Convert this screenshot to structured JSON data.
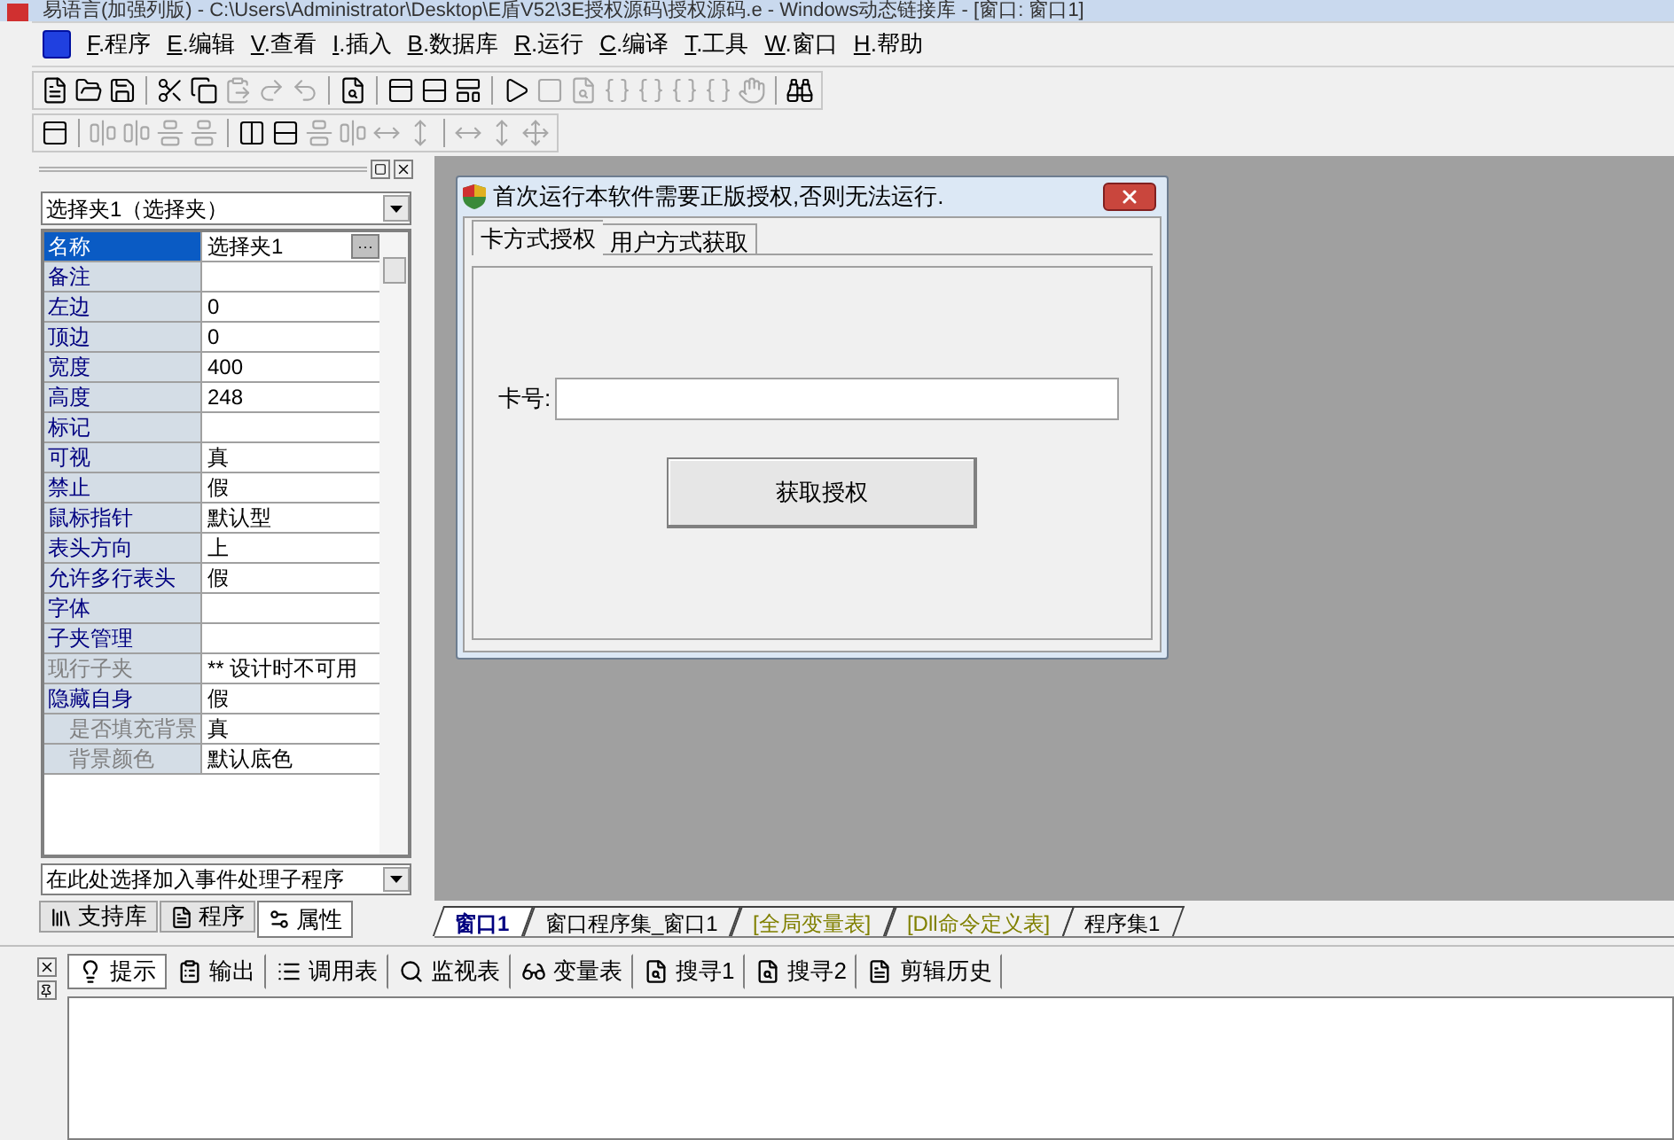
{
  "title_bar": {
    "title": "易语言(加强列版) - C:\\Users\\Administrator\\Desktop\\E盾V52\\3E授权源码\\授权源码.e - Windows动态链接库 - [窗口: 窗口1]"
  },
  "menu": [
    {
      "key": "F",
      "label": ".程序"
    },
    {
      "key": "E",
      "label": ".编辑"
    },
    {
      "key": "V",
      "label": ".查看"
    },
    {
      "key": "I",
      "label": ".插入"
    },
    {
      "key": "B",
      "label": ".数据库"
    },
    {
      "key": "R",
      "label": ".运行"
    },
    {
      "key": "C",
      "label": ".编译"
    },
    {
      "key": "T",
      "label": ".工具"
    },
    {
      "key": "W",
      "label": ".窗口"
    },
    {
      "key": "H",
      "label": ".帮助"
    }
  ],
  "properties": {
    "object_selector": "选择夹1（选择夹）",
    "rows": [
      {
        "name": "名称",
        "value": "选择夹1",
        "selected": true,
        "disabled": false,
        "button": "···"
      },
      {
        "name": "备注",
        "value": "",
        "selected": false,
        "disabled": false
      },
      {
        "name": "左边",
        "value": "0",
        "selected": false,
        "disabled": false
      },
      {
        "name": "顶边",
        "value": "0",
        "selected": false,
        "disabled": false
      },
      {
        "name": "宽度",
        "value": "400",
        "selected": false,
        "disabled": false
      },
      {
        "name": "高度",
        "value": "248",
        "selected": false,
        "disabled": false
      },
      {
        "name": "标记",
        "value": "",
        "selected": false,
        "disabled": false
      },
      {
        "name": "可视",
        "value": "真",
        "selected": false,
        "disabled": false
      },
      {
        "name": "禁止",
        "value": "假",
        "selected": false,
        "disabled": false
      },
      {
        "name": "鼠标指针",
        "value": "默认型",
        "selected": false,
        "disabled": false
      },
      {
        "name": "表头方向",
        "value": "上",
        "selected": false,
        "disabled": false
      },
      {
        "name": "允许多行表头",
        "value": "假",
        "selected": false,
        "disabled": false
      },
      {
        "name": "字体",
        "value": "",
        "selected": false,
        "disabled": false
      },
      {
        "name": "子夹管理",
        "value": "",
        "selected": false,
        "disabled": false
      },
      {
        "name": "现行子夹",
        "value": "** 设计时不可用",
        "selected": false,
        "disabled": true
      },
      {
        "name": "隐藏自身",
        "value": "假",
        "selected": false,
        "disabled": false,
        "children": [
          {
            "name": "是否填充背景",
            "value": "真",
            "selected": false,
            "disabled": true
          },
          {
            "name": "背景颜色",
            "value": "默认底色",
            "selected": false,
            "disabled": true
          }
        ]
      }
    ]
  },
  "event_selector": "在此处选择加入事件处理子程序",
  "panel_tabs": [
    {
      "label": "支持库",
      "selected": false
    },
    {
      "label": "程序",
      "selected": false
    },
    {
      "label": "属性",
      "selected": true
    }
  ],
  "dialog": {
    "title": "首次运行本软件需要正版授权,否则无法运行.",
    "tabs": [
      {
        "label": "卡方式授权",
        "selected": true
      },
      {
        "label": "用户方式获取",
        "selected": false
      }
    ],
    "card_label": "卡号:",
    "button": "获取授权"
  },
  "doc_tabs": [
    {
      "label": "窗口1",
      "selected": true,
      "kind": "code"
    },
    {
      "label": "窗口程序集_窗口1",
      "selected": false,
      "kind": "code"
    },
    {
      "label": "[全局变量表]",
      "selected": false,
      "kind": "table"
    },
    {
      "label": "[Dll命令定义表]",
      "selected": false,
      "kind": "table"
    },
    {
      "label": "程序集1",
      "selected": false,
      "kind": "code"
    }
  ],
  "output_tabs": [
    {
      "label": "提示",
      "selected": true
    },
    {
      "label": "输出",
      "selected": false
    },
    {
      "label": "调用表",
      "selected": false
    },
    {
      "label": "监视表",
      "selected": false
    },
    {
      "label": "变量表",
      "selected": false
    },
    {
      "label": "搜寻1",
      "selected": false
    },
    {
      "label": "搜寻2",
      "selected": false
    },
    {
      "label": "剪辑历史",
      "selected": false
    }
  ]
}
